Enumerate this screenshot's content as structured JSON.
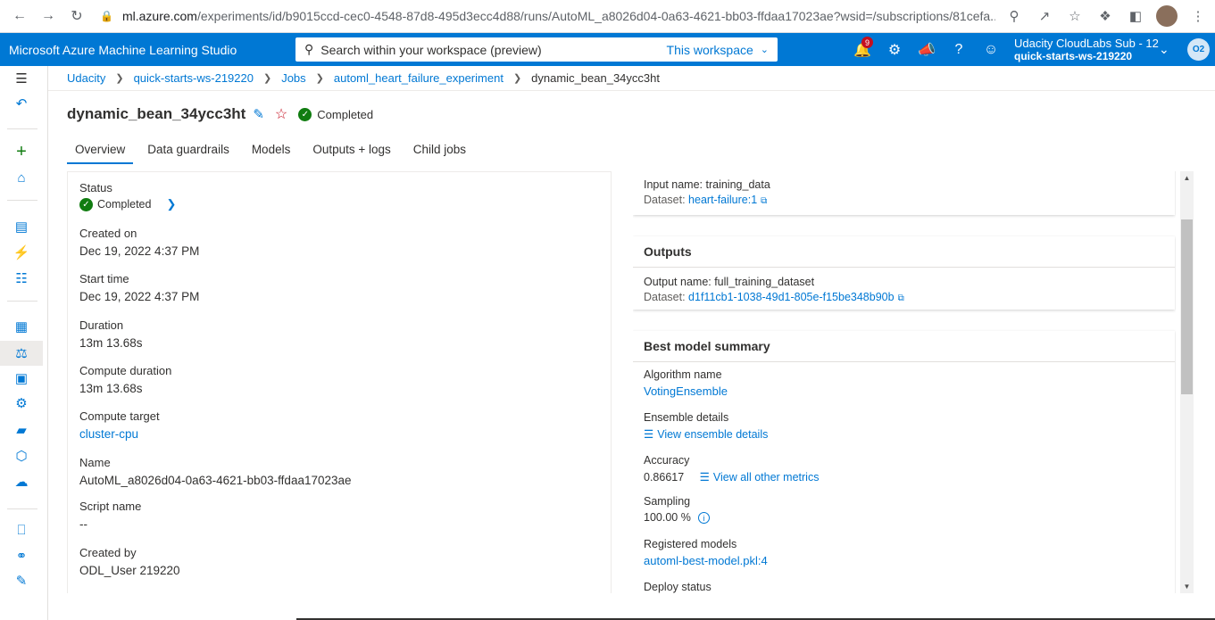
{
  "browser": {
    "url_host": "ml.azure.com",
    "url_path": "/experiments/id/b9015ccd-cec0-4548-87d8-495d3ecc4d88/runs/AutoML_a8026d04-0a63-4621-bb03-ffdaa17023ae?wsid=/subscriptions/81cefa..."
  },
  "header": {
    "brand": "Microsoft Azure Machine Learning Studio",
    "search_placeholder": "Search within your workspace (preview)",
    "search_scope": "This workspace",
    "notification_count": "9",
    "account_name": "Udacity CloudLabs Sub - 12",
    "account_workspace": "quick-starts-ws-219220",
    "avatar_initials": "O2"
  },
  "breadcrumb": {
    "items": [
      "Udacity",
      "quick-starts-ws-219220",
      "Jobs",
      "automl_heart_failure_experiment"
    ],
    "current": "dynamic_bean_34ycc3ht"
  },
  "run": {
    "title": "dynamic_bean_34ycc3ht",
    "status": "Completed"
  },
  "tabs": [
    "Overview",
    "Data guardrails",
    "Models",
    "Outputs + logs",
    "Child jobs"
  ],
  "details": {
    "status_label": "Status",
    "status_value": "Completed",
    "created_on_label": "Created on",
    "created_on_value": "Dec 19, 2022 4:37 PM",
    "start_time_label": "Start time",
    "start_time_value": "Dec 19, 2022 4:37 PM",
    "duration_label": "Duration",
    "duration_value": "13m 13.68s",
    "compute_duration_label": "Compute duration",
    "compute_duration_value": "13m 13.68s",
    "compute_target_label": "Compute target",
    "compute_target_value": "cluster-cpu",
    "name_label": "Name",
    "name_value": "AutoML_a8026d04-0a63-4621-bb03-ffdaa17023ae",
    "script_name_label": "Script name",
    "script_name_value": "--",
    "created_by_label": "Created by",
    "created_by_value": "ODL_User 219220"
  },
  "inputs": {
    "input_name": "Input name: training_data",
    "dataset_label": "Dataset:",
    "dataset_value": "heart-failure:1"
  },
  "outputs": {
    "heading": "Outputs",
    "output_name": "Output name: full_training_dataset",
    "dataset_label": "Dataset:",
    "dataset_value": "d1f11cb1-1038-49d1-805e-f15be348b90b"
  },
  "best_model": {
    "heading": "Best model summary",
    "algorithm_label": "Algorithm name",
    "algorithm_value": "VotingEnsemble",
    "ensemble_label": "Ensemble details",
    "ensemble_link": "View ensemble details",
    "accuracy_label": "Accuracy",
    "accuracy_value": "0.86617",
    "metrics_link": "View all other metrics",
    "sampling_label": "Sampling",
    "sampling_value": "100.00 %",
    "registered_label": "Registered models",
    "registered_value": "automl-best-model.pkl:4",
    "deploy_label": "Deploy status"
  },
  "colors": {
    "accent": "#0078d4",
    "success": "#107c10",
    "favorite": "#c50f1f"
  }
}
